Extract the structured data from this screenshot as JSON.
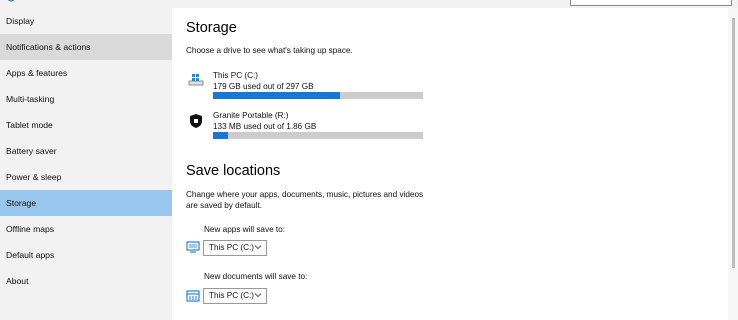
{
  "sidebar": {
    "items": [
      {
        "label": "Display"
      },
      {
        "label": "Notifications & actions"
      },
      {
        "label": "Apps & features"
      },
      {
        "label": "Multi-tasking"
      },
      {
        "label": "Tablet mode"
      },
      {
        "label": "Battery saver"
      },
      {
        "label": "Power & sleep"
      },
      {
        "label": "Storage"
      },
      {
        "label": "Offline maps"
      },
      {
        "label": "Default apps"
      },
      {
        "label": "About"
      }
    ],
    "hovered": "Notifications & actions",
    "selected": "Storage"
  },
  "storage": {
    "title": "Storage",
    "subtitle": "Choose a drive to see what's taking up space.",
    "drives": [
      {
        "name": "This PC (C:)",
        "usage": "179 GB used out of 297 GB",
        "used_fraction": 0.603,
        "icon": "windows-drive-icon"
      },
      {
        "name": "Granite Portable (R:)",
        "usage": "133 MB used out of 1.86 GB",
        "used_fraction": 0.07,
        "icon": "shield-drive-icon"
      }
    ]
  },
  "save_locations": {
    "title": "Save locations",
    "description_line1": "Change where your apps, documents, music, pictures and videos",
    "description_line2": "are saved by default.",
    "apps_label": "New apps will save to:",
    "apps_value": "This PC (C:)",
    "docs_label": "New documents will save to:",
    "docs_value": "This PC (C:)"
  },
  "colors": {
    "accent": "#1778d4",
    "selected_bg": "#99c6ec",
    "hover_bg": "#dadada",
    "track": "#cccccc"
  }
}
